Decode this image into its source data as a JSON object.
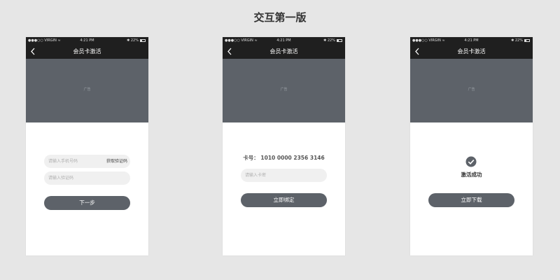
{
  "page": {
    "title": "交互第一版"
  },
  "status_bar": {
    "carrier": "●●●○○ VIRGIN ≈",
    "time": "4:21 PM",
    "battery": "✱ 22%"
  },
  "screens": [
    {
      "nav_title": "会员卡激活",
      "ad_label": "广告",
      "phone_input_placeholder": "请输入手机号码",
      "get_code_label": "获取验证码",
      "code_input_placeholder": "请输入验证码",
      "next_button": "下一步"
    },
    {
      "nav_title": "会员卡激活",
      "ad_label": "广告",
      "card_label": "卡号：",
      "card_number": "1010 0000 2356 3146",
      "password_placeholder": "请输入卡密",
      "bind_button": "立即绑定"
    },
    {
      "nav_title": "会员卡激活",
      "ad_label": "广告",
      "success_text": "激活成功",
      "download_button": "立即下载"
    }
  ],
  "colors": {
    "background": "#e6e6e6",
    "dark_bar": "#1f1f1f",
    "ad_gray": "#5d6269",
    "button": "#5d6269"
  },
  "icons": {
    "back": "chevron-left-icon",
    "success": "check-circle-icon",
    "wifi": "wifi-icon",
    "battery": "battery-icon"
  }
}
